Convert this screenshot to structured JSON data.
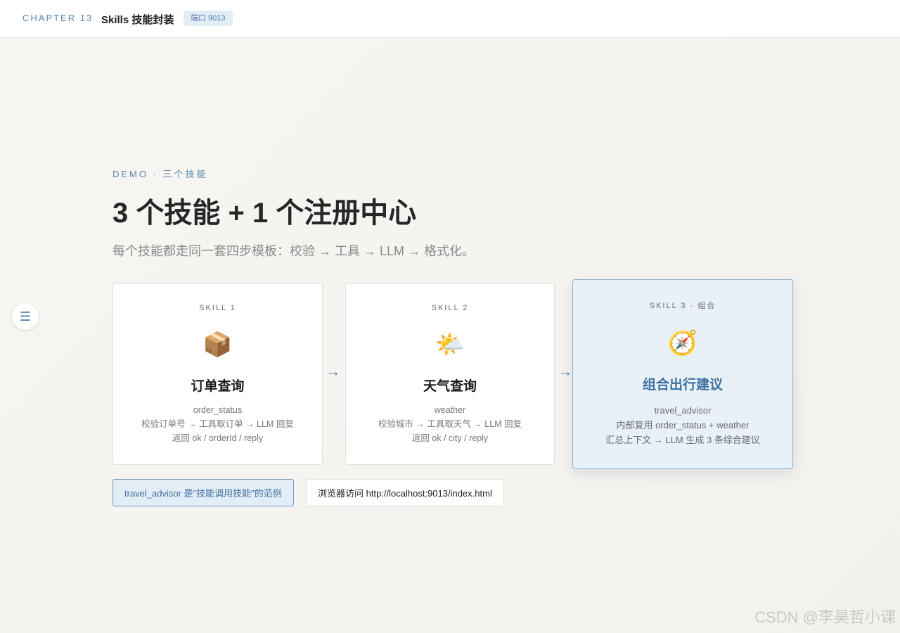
{
  "header": {
    "chapter": "CHAPTER 13",
    "title": "Skills 技能封装",
    "port": "端口 9013"
  },
  "hero": {
    "kicker": "DEMO · 三个技能",
    "title": "3 个技能 + 1 个注册中心",
    "subtitle": "每个技能都走同一套四步模板：校验 → 工具 → LLM → 格式化。"
  },
  "menu_icon": "menu-icon",
  "cards": [
    {
      "skill": "SKILL 1",
      "icon": "📦",
      "icon_name": "package-icon",
      "name": "订单查询",
      "lines": [
        "order_status",
        "校验订单号 → 工具取订单 → LLM 回复",
        "返回 ok / orderId / reply"
      ]
    },
    {
      "skill": "SKILL 2",
      "icon": "🌤️",
      "icon_name": "weather-icon",
      "name": "天气查询",
      "lines": [
        "weather",
        "校验城市 → 工具取天气 → LLM 回复",
        "返回 ok / city / reply"
      ]
    },
    {
      "skill": "SKILL 3 · 组合",
      "icon": "🧭",
      "icon_name": "compass-icon",
      "name": "组合出行建议",
      "lines": [
        "travel_advisor",
        "内部复用 order_status + weather",
        "汇总上下文 → LLM 生成 3 条综合建议"
      ]
    }
  ],
  "arrow": "→",
  "chips": {
    "example": "travel_advisor 是\"技能调用技能\"的范例",
    "visit": "浏览器访问 http://localhost:9013/index.html"
  },
  "watermark": "CSDN @李昊哲小课",
  "colors": {
    "accent": "#4c7aa3",
    "highlight_bg": "#e8f0f8"
  }
}
